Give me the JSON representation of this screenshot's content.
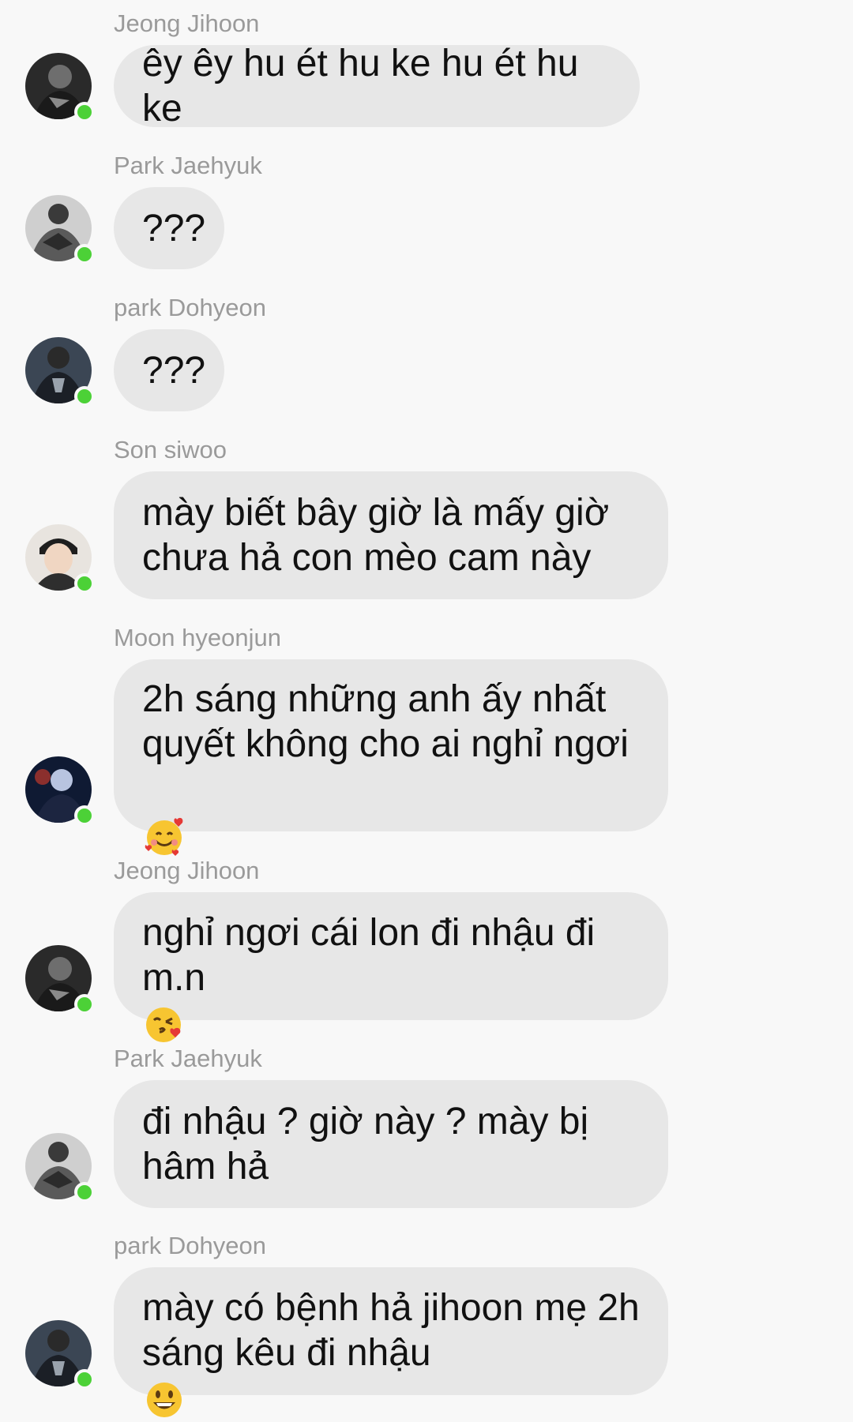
{
  "colors": {
    "background": "#f8f8f8",
    "bubble": "#e7e7e7",
    "sender_name": "#9a9a9a",
    "text": "#111111",
    "online": "#4cd137"
  },
  "messages": [
    {
      "sender": "Jeong Jihoon",
      "text": "êy êy hu ét hu ke hu ét hu ke",
      "avatar": "jeong-jihoon-avatar",
      "online": true
    },
    {
      "sender": "Park Jaehyuk",
      "text": "???",
      "avatar": "park-jaehyuk-avatar",
      "online": true
    },
    {
      "sender": "park Dohyeon",
      "text": "???",
      "avatar": "park-dohyeon-avatar",
      "online": true
    },
    {
      "sender": "Son siwoo",
      "text": "mày biết bây giờ là mấy giờ\nchưa hả con mèo cam này",
      "avatar": "son-siwoo-avatar",
      "online": true
    },
    {
      "sender": "Moon hyeonjun",
      "text": "2h sáng những anh ấy nhất\nquyết không cho ai nghỉ ngơi",
      "emoji": "smiling-face-with-hearts-emoji",
      "avatar": "moon-hyeonjun-avatar",
      "online": true
    },
    {
      "sender": "Jeong Jihoon",
      "text": "nghỉ ngơi cái lon đi nhậu đi\nm.n",
      "emoji": "face-blowing-kiss-emoji",
      "avatar": "jeong-jihoon-avatar",
      "online": true
    },
    {
      "sender": "Park Jaehyuk",
      "text": "đi nhậu ? giờ này ? mày bị\nhâm hả",
      "avatar": "park-jaehyuk-avatar",
      "online": true
    },
    {
      "sender": "park Dohyeon",
      "text": "mày có bệnh hả jihoon mẹ 2h\nsáng kêu đi nhậu",
      "emoji": "grinning-face-emoji",
      "avatar": "park-dohyeon-avatar",
      "online": true
    }
  ]
}
